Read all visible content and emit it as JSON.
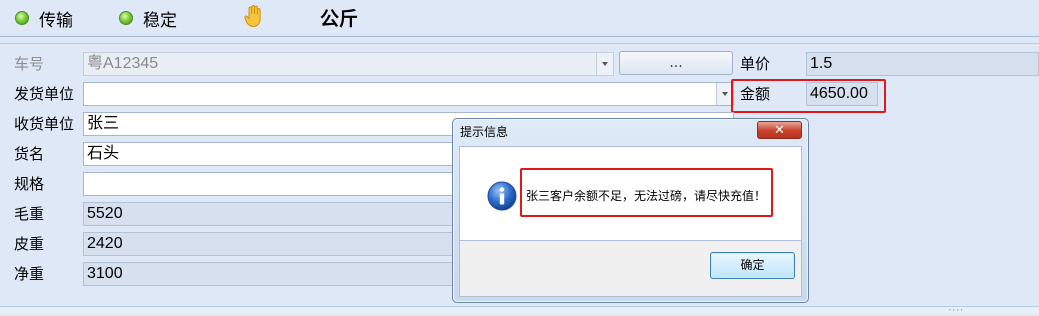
{
  "status": {
    "transmit": {
      "label": "传输",
      "state_color": "#5fb52a"
    },
    "stable": {
      "label": "稳定",
      "state_color": "#5fb52a"
    },
    "unit": "公斤"
  },
  "form": {
    "plate": {
      "label": "车号",
      "value": "粤A12345",
      "browse_label": "..."
    },
    "shipper": {
      "label": "发货单位",
      "value": ""
    },
    "receiver": {
      "label": "收货单位",
      "value": "张三"
    },
    "goods": {
      "label": "货名",
      "value": "石头"
    },
    "spec": {
      "label": "规格",
      "value": ""
    },
    "gross": {
      "label": "毛重",
      "value": "5520"
    },
    "tare": {
      "label": "皮重",
      "value": "2420"
    },
    "net": {
      "label": "净重",
      "value": "3100"
    },
    "unit_price": {
      "label": "单价",
      "value": "1.5"
    },
    "amount": {
      "label": "金额",
      "value": "4650.00"
    }
  },
  "dialog": {
    "title": "提示信息",
    "close_label": "✕",
    "message": "张三客户余额不足，无法过磅，请尽快充值！",
    "ok_label": "确定"
  },
  "colors": {
    "highlight": "#e01818",
    "background": "#dfe8f6"
  }
}
